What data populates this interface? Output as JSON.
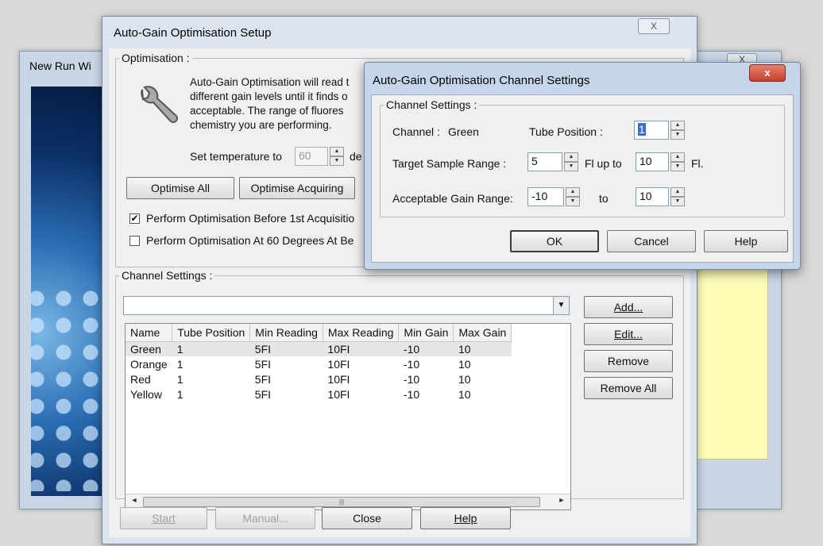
{
  "background_window": {
    "title": "New Run Wi",
    "close": "X"
  },
  "setup_dialog": {
    "title": "Auto-Gain Optimisation Setup",
    "close": "X",
    "optimisation": {
      "legend": "Optimisation :",
      "description": "Auto-Gain Optimisation will read t different gain levels until it finds o acceptable. The range of fluores chemistry you are performing.",
      "temp_label": "Set temperature to",
      "temp_value": "60",
      "temp_suffix": "de",
      "optimise_all": "Optimise All",
      "optimise_acquiring": "Optimise Acquiring",
      "check1": {
        "label": "Perform Optimisation Before 1st Acquisitio",
        "checked": true,
        "mark": "✔"
      },
      "check2": {
        "label": "Perform Optimisation At 60 Degrees At Be",
        "checked": false,
        "mark": ""
      }
    },
    "channel_settings": {
      "legend": "Channel Settings :",
      "combo_value": "",
      "columns": [
        "Name",
        "Tube Position",
        "Min Reading",
        "Max Reading",
        "Min Gain",
        "Max Gain"
      ],
      "rows": [
        [
          "Green",
          "1",
          "5FI",
          "10FI",
          "-10",
          "10"
        ],
        [
          "Orange",
          "1",
          "5FI",
          "10FI",
          "-10",
          "10"
        ],
        [
          "Red",
          "1",
          "5FI",
          "10FI",
          "-10",
          "10"
        ],
        [
          "Yellow",
          "1",
          "5FI",
          "10FI",
          "-10",
          "10"
        ]
      ],
      "add": "Add...",
      "edit": "Edit...",
      "remove": "Remove",
      "remove_all": "Remove All"
    },
    "footer": {
      "start": "Start",
      "manual": "Manual...",
      "close": "Close",
      "help": "Help"
    }
  },
  "channel_dialog": {
    "title": "Auto-Gain Optimisation Channel Settings",
    "close": "x",
    "legend": "Channel Settings :",
    "channel_label": "Channel :",
    "channel_value": "Green",
    "tube_position_label": "Tube Position :",
    "tube_position_value": "1",
    "target_label": "Target Sample Range :",
    "target_min": "5",
    "fl_up_to": "Fl up to",
    "target_max": "10",
    "fl_unit": "Fl.",
    "gain_label": "Acceptable Gain Range:",
    "gain_min": "-10",
    "to_label": "to",
    "gain_max": "10",
    "ok": "OK",
    "cancel": "Cancel",
    "help": "Help"
  }
}
